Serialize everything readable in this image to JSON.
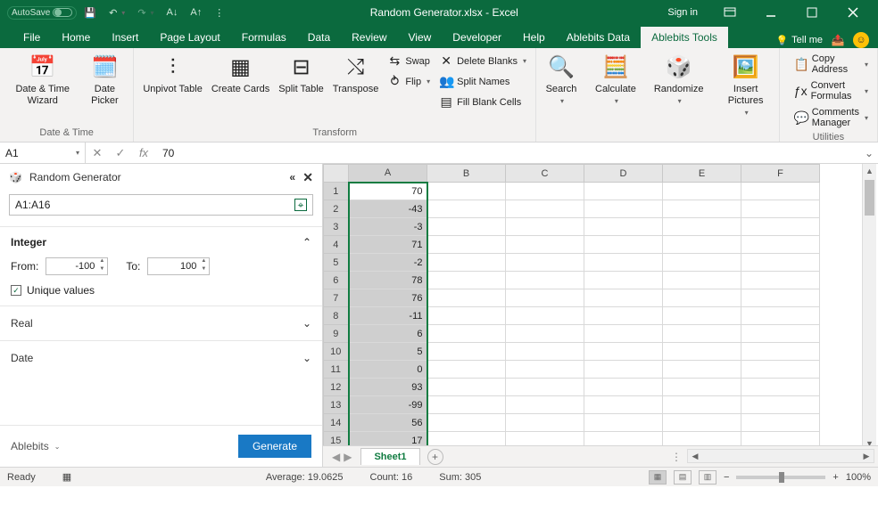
{
  "title_bar": {
    "autosave_label": "AutoSave",
    "autosave_state": "Off",
    "document_title": "Random Generator.xlsx - Excel",
    "signin_label": "Sign in"
  },
  "tabs": {
    "items": [
      "File",
      "Home",
      "Insert",
      "Page Layout",
      "Formulas",
      "Data",
      "Review",
      "View",
      "Developer",
      "Help",
      "Ablebits Data",
      "Ablebits Tools"
    ],
    "active_index": 11,
    "tell_me": "Tell me"
  },
  "ribbon": {
    "groups": {
      "date_time": {
        "label": "Date & Time",
        "items": {
          "date_time_wizard": "Date & Time Wizard",
          "date_picker": "Date Picker"
        }
      },
      "transform": {
        "label": "Transform",
        "items": {
          "unpivot": "Unpivot Table",
          "create_cards": "Create Cards",
          "split_table": "Split Table",
          "transpose": "Transpose",
          "swap": "Swap",
          "flip": "Flip",
          "delete_blanks": "Delete Blanks",
          "split_names": "Split Names",
          "fill_blank": "Fill Blank Cells"
        }
      },
      "mid": {
        "search": "Search",
        "calculate": "Calculate",
        "randomize": "Randomize",
        "insert_pictures": "Insert Pictures"
      },
      "utilities": {
        "label": "Utilities",
        "items": {
          "copy_address": "Copy Address",
          "convert_formulas": "Convert Formulas",
          "comments_manager": "Comments Manager"
        }
      }
    }
  },
  "formula_bar": {
    "name_box": "A1",
    "fx_label": "fx",
    "value": "70"
  },
  "taskpane": {
    "title": "Random Generator",
    "range": "A1:A16",
    "sections": {
      "integer": {
        "title": "Integer",
        "from_label": "From:",
        "from_value": "-100",
        "to_label": "To:",
        "to_value": "100",
        "unique_label": "Unique values",
        "unique_checked": true
      },
      "real": {
        "title": "Real"
      },
      "date": {
        "title": "Date"
      }
    },
    "brand": "Ablebits",
    "generate_label": "Generate"
  },
  "chart_data": {
    "type": "table",
    "columns": [
      "A",
      "B",
      "C",
      "D",
      "E",
      "F"
    ],
    "row_headers": [
      1,
      2,
      3,
      4,
      5,
      6,
      7,
      8,
      9,
      10,
      11,
      12,
      13,
      14,
      15
    ],
    "values_A": [
      70,
      -43,
      -3,
      71,
      -2,
      78,
      76,
      -11,
      6,
      5,
      0,
      93,
      -99,
      56,
      17
    ],
    "selection": "A1:A16",
    "active_cell": "A1"
  },
  "sheet_tabs": {
    "active": "Sheet1"
  },
  "status_bar": {
    "ready": "Ready",
    "average_label": "Average:",
    "average_value": "19.0625",
    "count_label": "Count:",
    "count_value": "16",
    "sum_label": "Sum:",
    "sum_value": "305",
    "zoom": "100%"
  }
}
